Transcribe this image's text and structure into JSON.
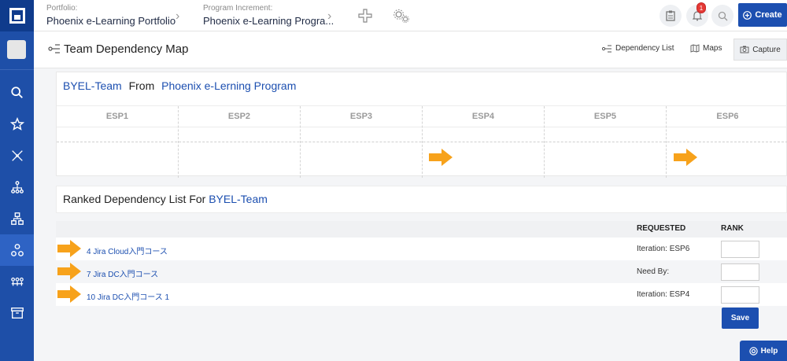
{
  "breadcrumbs": [
    {
      "label": "Portfolio:",
      "value": "Phoenix e-Learning Portfolio"
    },
    {
      "label": "Program Increment:",
      "value": "Phoenix e-Learning Progra..."
    }
  ],
  "notifications": {
    "count": "1"
  },
  "create_label": "Create",
  "page_title": "Team Dependency Map",
  "toolbar": {
    "dependency_list": "Dependency List",
    "maps": "Maps",
    "capture": "Capture"
  },
  "map_header": {
    "team": "BYEL-Team",
    "from": "From",
    "program": "Phoenix e-Lerning Program"
  },
  "sprints": [
    "ESP1",
    "ESP2",
    "ESP3",
    "ESP4",
    "ESP5",
    "ESP6"
  ],
  "ranked": {
    "prefix": "Ranked Dependency List For",
    "team": "BYEL-Team"
  },
  "columns": {
    "requested": "REQUESTED",
    "rank": "RANK"
  },
  "rows": [
    {
      "item": "4 Jira Cloud入門コース",
      "requested": "Iteration: ESP6"
    },
    {
      "item": "7 Jira DC入門コース",
      "requested": "Need By:"
    },
    {
      "item": "10 Jira DC入門コース 1",
      "requested": "Iteration: ESP4"
    }
  ],
  "save_label": "Save",
  "help_label": "Help",
  "colors": {
    "accent": "#1c4fb0",
    "sidebar": "#1e4fa8",
    "arrow": "#f7a21b"
  }
}
